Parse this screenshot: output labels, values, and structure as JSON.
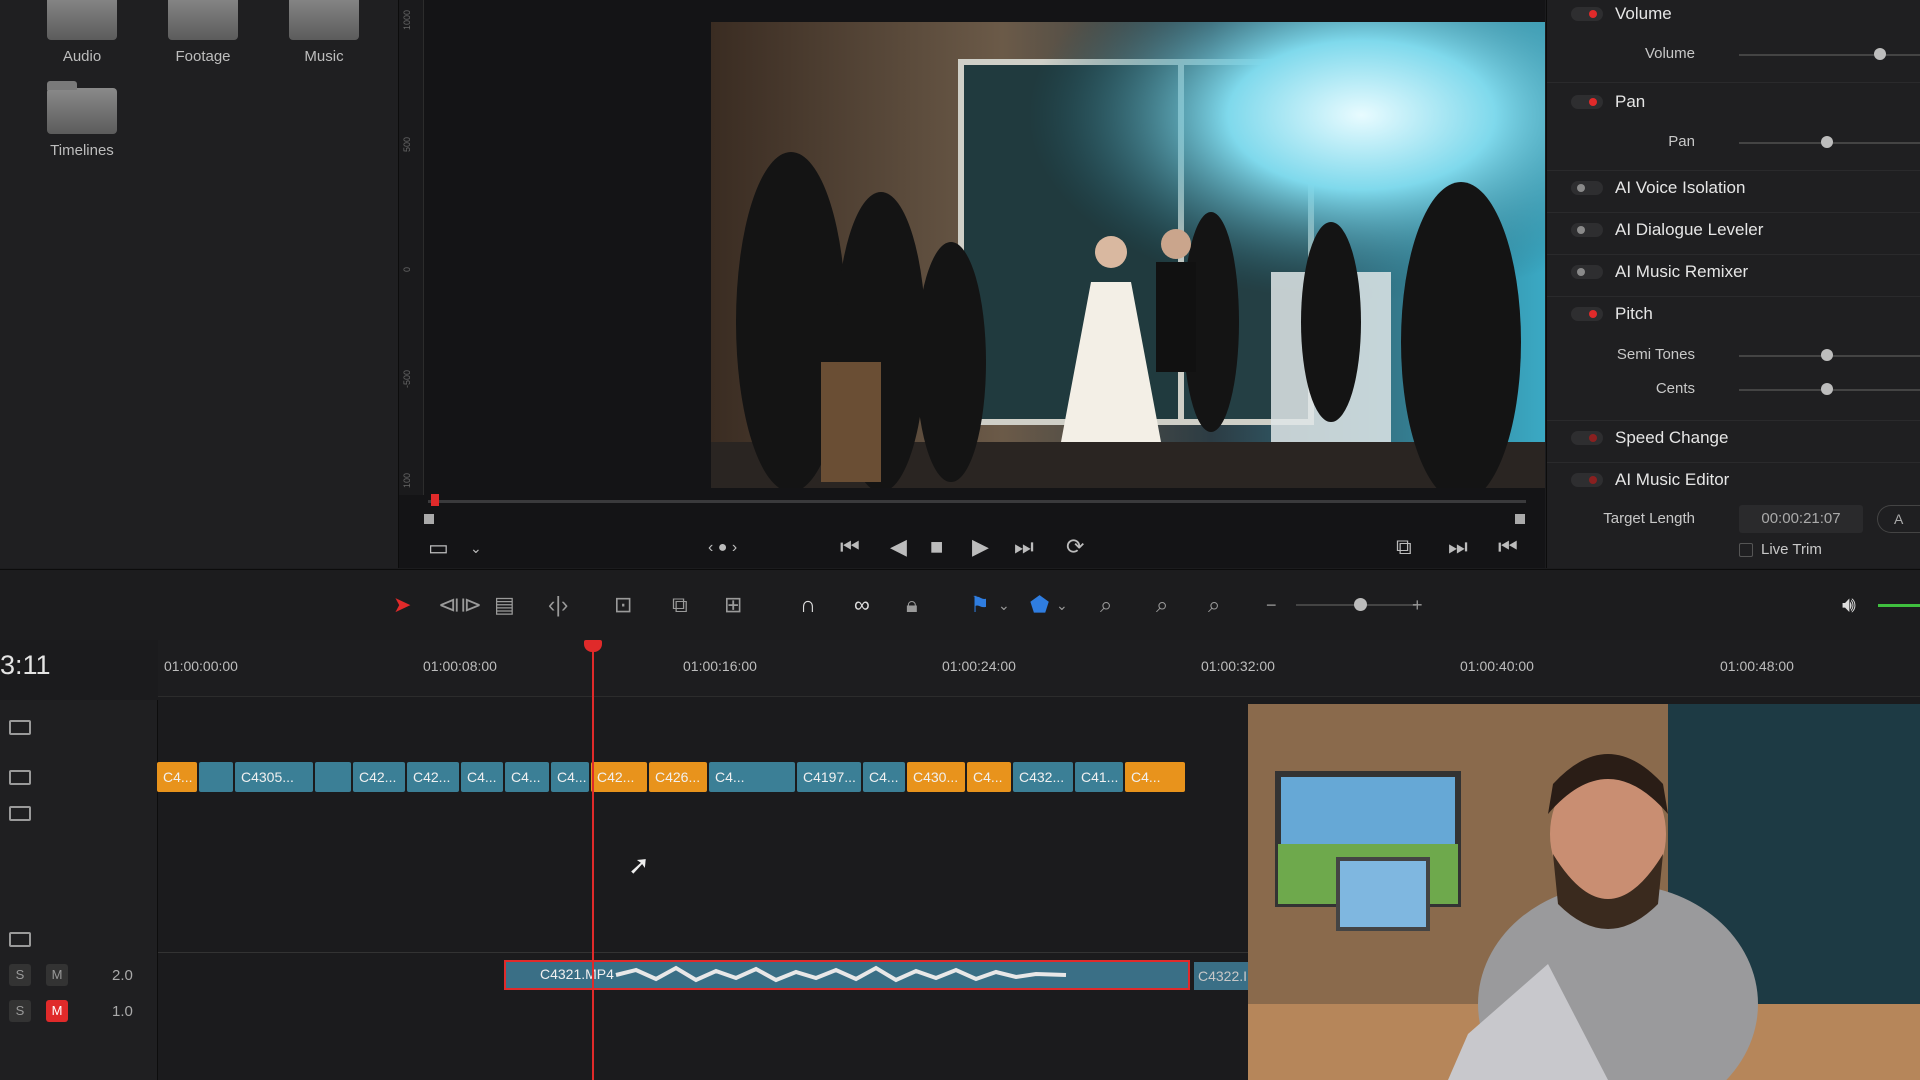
{
  "media_pool": {
    "folders": [
      "Audio",
      "Footage",
      "Music",
      "Timelines"
    ]
  },
  "viewer": {
    "ruler_ticks": [
      "1000",
      "500",
      "0",
      "-500",
      "100"
    ]
  },
  "inspector": {
    "volume": {
      "title": "Volume",
      "param": "Volume",
      "value": 0.8
    },
    "pan": {
      "title": "Pan",
      "param": "Pan",
      "value": 0.5
    },
    "voice_isolation": "AI Voice Isolation",
    "dialogue_leveler": "AI Dialogue Leveler",
    "music_remixer": "AI Music Remixer",
    "pitch": {
      "title": "Pitch",
      "semi_tones": "Semi Tones",
      "cents": "Cents",
      "semi_value": 0.5,
      "cents_value": 0.5
    },
    "speed_change": "Speed Change",
    "music_editor": {
      "title": "AI Music Editor",
      "target_length_label": "Target Length",
      "target_length": "00:00:21:07",
      "live_trim": "Live Trim",
      "partial_button": "A"
    }
  },
  "timeline": {
    "timecode": "3:11",
    "ruler": [
      "01:00:00:00",
      "01:00:08:00",
      "01:00:16:00",
      "01:00:24:00",
      "01:00:32:00",
      "01:00:40:00",
      "01:00:48:00"
    ],
    "video_clips": [
      {
        "label": "C4...",
        "color": "orange"
      },
      {
        "label": "",
        "color": "teal"
      },
      {
        "label": "C4305...",
        "color": "teal"
      },
      {
        "label": "",
        "color": "teal"
      },
      {
        "label": "C42...",
        "color": "teal"
      },
      {
        "label": "C42...",
        "color": "teal"
      },
      {
        "label": "C4...",
        "color": "teal"
      },
      {
        "label": "C4...",
        "color": "teal"
      },
      {
        "label": "C4...",
        "color": "teal"
      },
      {
        "label": "C42...",
        "color": "orange"
      },
      {
        "label": "C426...",
        "color": "orange"
      },
      {
        "label": "C4...",
        "color": "teal"
      },
      {
        "label": "C4197...",
        "color": "teal"
      },
      {
        "label": "C4...",
        "color": "teal"
      },
      {
        "label": "C430...",
        "color": "orange"
      },
      {
        "label": "C4...",
        "color": "orange"
      },
      {
        "label": "C432...",
        "color": "teal"
      },
      {
        "label": "C41...",
        "color": "teal"
      },
      {
        "label": "C4...",
        "color": "orange"
      }
    ],
    "audio_clip": "C4321.MP4",
    "audio_clip_next": "C4322.I",
    "audio_tracks": [
      {
        "solo": "S",
        "mute": "M",
        "level": "2.0",
        "muted": false
      },
      {
        "solo": "S",
        "mute": "M",
        "level": "1.0",
        "muted": true
      }
    ]
  },
  "colors": {
    "accent_red": "#e02a2a",
    "clip_teal": "#3b7f96",
    "clip_orange": "#e8931c"
  },
  "icons": [
    "select-arrow-icon",
    "trim-icon",
    "blade-icon",
    "slip-icon",
    "overwrite-icon",
    "replace-icon",
    "snap-icon",
    "link-icon",
    "lock-icon",
    "flag-icon",
    "marker-icon",
    "zoom-icon",
    "volume-icon"
  ]
}
